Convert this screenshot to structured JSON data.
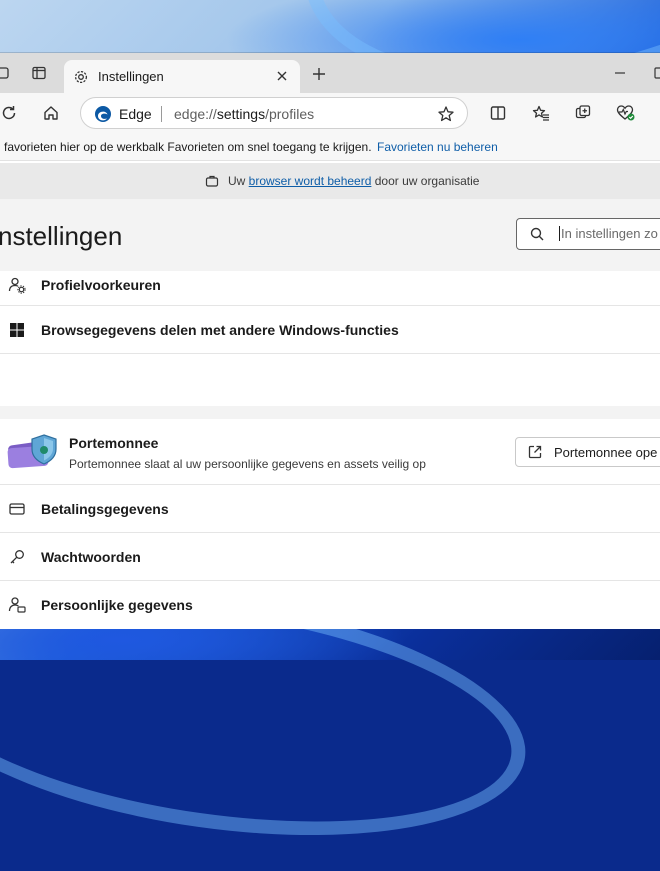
{
  "tab": {
    "title": "Instellingen"
  },
  "address_bar": {
    "site_label": "Edge",
    "url_prefix": "edge://",
    "url_bold": "settings",
    "url_suffix": "/profiles"
  },
  "favorites_bar": {
    "message": "favorieten hier op de werkbalk Favorieten om snel toegang te krijgen.",
    "link": "Favorieten nu beheren"
  },
  "managed_banner": {
    "prefix": "Uw ",
    "link": "browser wordt beheerd",
    "suffix": " door uw organisatie"
  },
  "settings": {
    "title": "nstellingen",
    "search_placeholder": "In instellingen zo"
  },
  "rows_top": [
    {
      "label": "Profielvoorkeuren",
      "icon": "profile-settings-icon"
    },
    {
      "label": "Browsegegevens delen met andere Windows-functies",
      "icon": "windows-logo-icon"
    }
  ],
  "wallet": {
    "title": "Portemonnee",
    "description": "Portemonnee slaat al uw persoonlijke gegevens en assets veilig op",
    "button_label": "Portemonnee ope"
  },
  "rows_bottom": [
    {
      "label": "Betalingsgegevens",
      "icon": "credit-card-icon"
    },
    {
      "label": "Wachtwoorden",
      "icon": "key-icon"
    },
    {
      "label": "Persoonlijke gegevens",
      "icon": "personal-info-icon"
    }
  ],
  "colors": {
    "link": "#0f5ea8",
    "edge_blue": "#0c59a4",
    "wallet_purple": "#7a5cc4"
  }
}
